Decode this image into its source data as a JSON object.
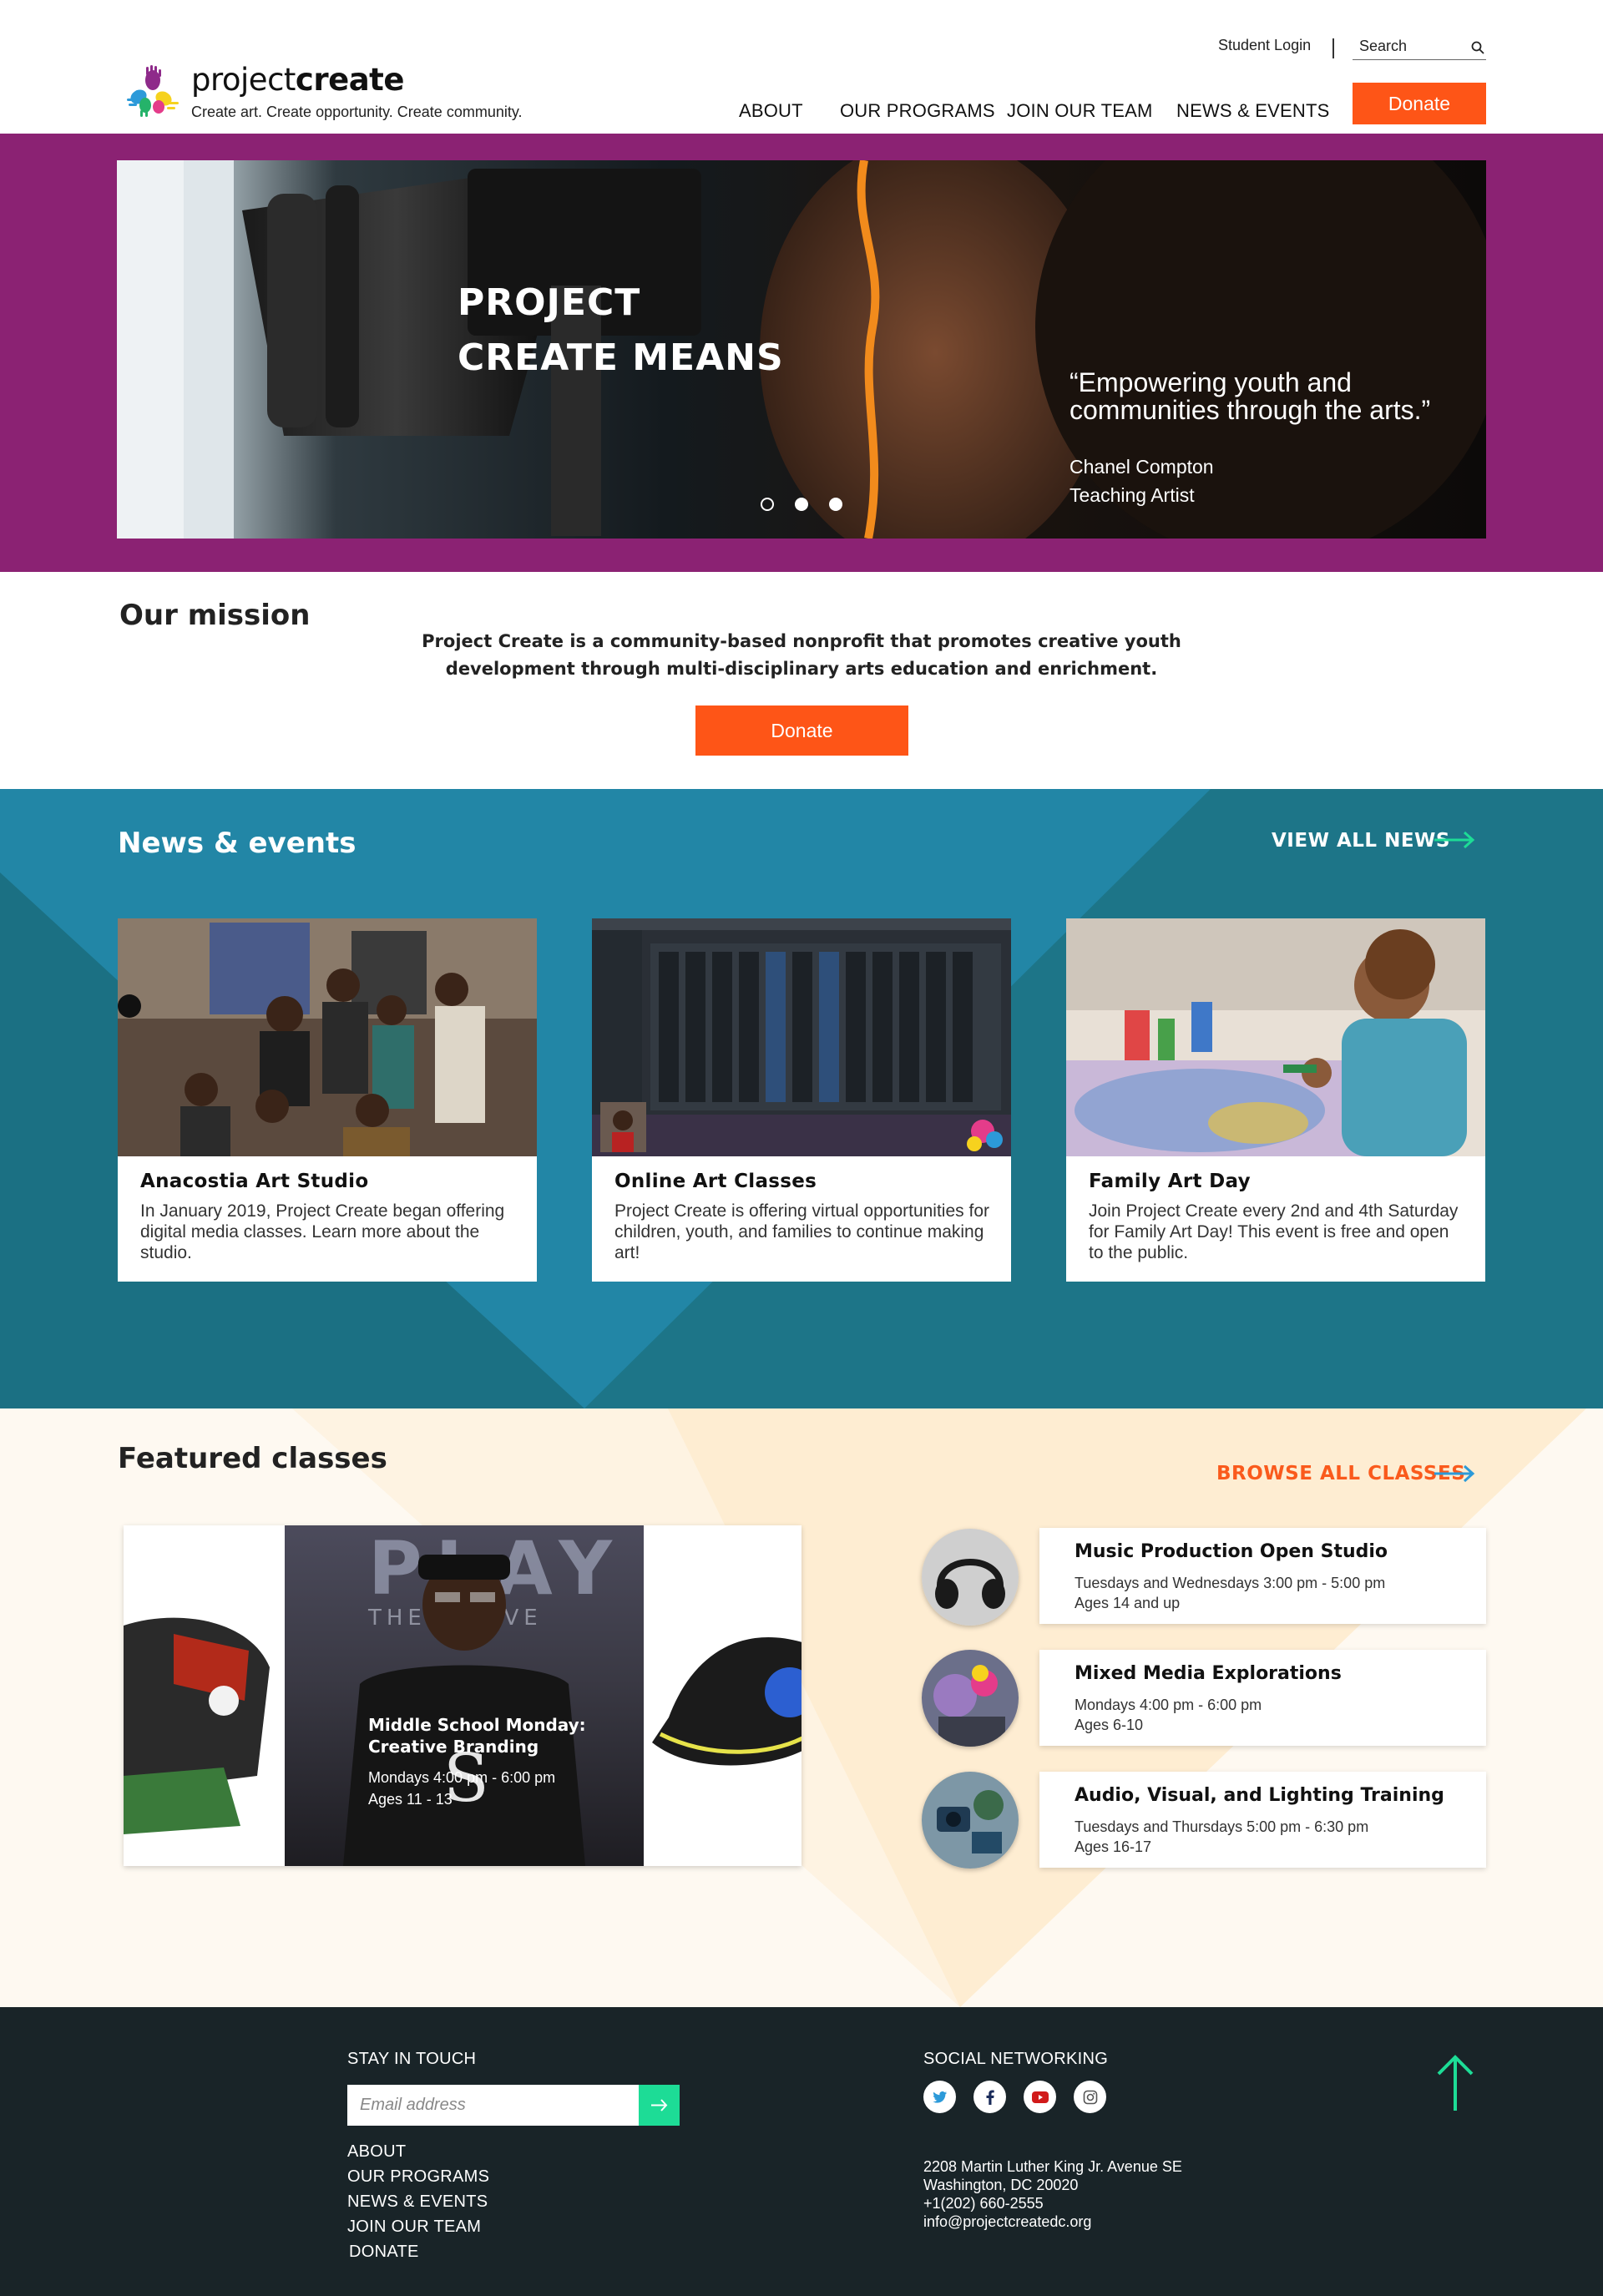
{
  "header": {
    "brand_light": "project",
    "brand_bold": "create",
    "tagline": "Create art. Create opportunity. Create community.",
    "student_login": "Student Login",
    "search_placeholder": "Search",
    "nav": [
      "ABOUT",
      "OUR PROGRAMS",
      "JOIN OUR TEAM",
      "NEWS & EVENTS"
    ],
    "donate": "Donate"
  },
  "hero": {
    "title": "PROJECT CREATE MEANS",
    "quote": "“Empowering youth and communities through the arts.”",
    "name": "Chanel Compton",
    "role": "Teaching Artist",
    "slides": 3,
    "active_slide": 3
  },
  "mission": {
    "title": "Our mission",
    "text": "Project Create is a community-based nonprofit that promotes creative youth development through multi-disciplinary arts education and enrichment.",
    "donate": "Donate"
  },
  "news": {
    "title": "News & events",
    "view_all": "VIEW ALL NEWS",
    "cards": [
      {
        "title": "Anacostia Art Studio",
        "text": "In January 2019, Project Create began offering digital media classes.  Learn more about the studio."
      },
      {
        "title": "Online Art Classes",
        "text": "Project Create is offering virtual opportunities for children, youth, and families to continue making art!"
      },
      {
        "title": "Family Art Day",
        "text": "Join Project Create every 2nd and 4th Saturday for Family Art Day!  This event is free and open to the public."
      }
    ]
  },
  "featured": {
    "title": "Featured classes",
    "browse_all": "BROWSE ALL CLASSES",
    "carousel": {
      "title": "Middle School Monday: Creative Branding",
      "time": "Mondays 4:00 pm - 6:00 pm",
      "ages": "Ages 11 - 13",
      "backdrop_text": "PLAY",
      "backdrop_sub": "THE    TIVE"
    },
    "classes": [
      {
        "title": "Music Production Open Studio",
        "time": "Tuesdays and Wednesdays 3:00 pm - 5:00 pm",
        "ages": "Ages 14 and up"
      },
      {
        "title": "Mixed Media Explorations",
        "time": "Mondays 4:00 pm - 6:00 pm",
        "ages": "Ages 6-10"
      },
      {
        "title": "Audio, Visual, and Lighting Training",
        "time": "Tuesdays and Thursdays 5:00 pm - 6:30 pm",
        "ages": "Ages 16-17"
      }
    ]
  },
  "footer": {
    "stay_in_touch": "STAY IN TOUCH",
    "email_placeholder": "Email address",
    "links": [
      "ABOUT",
      "OUR PROGRAMS",
      "NEWS & EVENTS",
      "JOIN OUR TEAM",
      "DONATE"
    ],
    "social_heading": "SOCIAL NETWORKING",
    "social_icons": [
      "twitter-icon",
      "facebook-icon",
      "youtube-icon",
      "instagram-icon"
    ],
    "address": [
      "2208 Martin Luther King Jr. Avenue SE",
      "Washington, DC 20020",
      "+1(202) 660-2555",
      "info@projectcreatedc.org"
    ]
  },
  "colors": {
    "brand_orange": "#fe5517",
    "hero_purple": "#8b2273",
    "news_teal": "#1d7588",
    "featured_cream": "#fef9f1",
    "footer_dark": "#192428",
    "accent_green": "#1ddc96"
  }
}
